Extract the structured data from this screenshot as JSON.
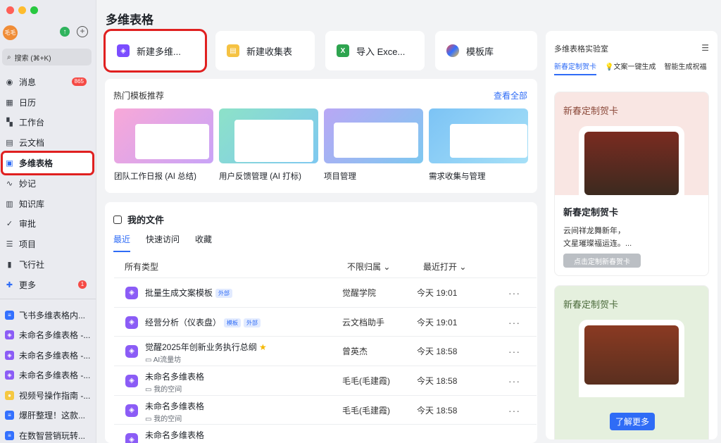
{
  "sidebar": {
    "avatar": "毛毛",
    "search": "搜索 (⌘+K)",
    "items": [
      {
        "label": "消息",
        "icon": "message-icon",
        "badge": "865"
      },
      {
        "label": "日历",
        "icon": "calendar-icon"
      },
      {
        "label": "工作台",
        "icon": "workbench-icon"
      },
      {
        "label": "云文档",
        "icon": "doc-icon"
      },
      {
        "label": "多维表格",
        "icon": "base-icon"
      },
      {
        "label": "妙记",
        "icon": "minutes-icon"
      },
      {
        "label": "知识库",
        "icon": "wiki-icon"
      },
      {
        "label": "审批",
        "icon": "approval-icon"
      },
      {
        "label": "项目",
        "icon": "project-icon"
      },
      {
        "label": "飞行社",
        "icon": "community-icon"
      },
      {
        "label": "更多",
        "icon": "more-apps-icon",
        "badge": "1"
      }
    ],
    "recent": [
      "飞书多维表格内...",
      "未命名多维表格 -...",
      "未命名多维表格 -...",
      "未命名多维表格 -...",
      "视频号操作指南 -...",
      "爆肝整理！这款...",
      "在数智营销玩转..."
    ]
  },
  "main": {
    "title": "多维表格",
    "quick": [
      "新建多维...",
      "新建收集表",
      "导入 Exce...",
      "模板库"
    ],
    "hot": {
      "title": "热门模板推荐",
      "view_all": "查看全部",
      "templates": [
        "团队工作日报 (AI 总结)",
        "用户反馈管理 (AI 打标)",
        "项目管理",
        "需求收集与管理"
      ]
    },
    "files": {
      "title": "我的文件",
      "tabs": [
        "最近",
        "快速访问",
        "收藏"
      ],
      "col_type": "所有类型",
      "col_owner": "不限归属",
      "col_time": "最近打开",
      "rows": [
        {
          "name": "批量生成文案模板",
          "tags": [
            "外部"
          ],
          "owner": "觉醒学院",
          "time": "今天 19:01"
        },
        {
          "name": "经营分析（仪表盘）",
          "tags": [
            "模板",
            "外部"
          ],
          "owner": "云文档助手",
          "time": "今天 19:01"
        },
        {
          "name": "觉醒2025年创新业务执行总纲",
          "sub": "AI流量坊",
          "owner": "曾英杰",
          "time": "今天 18:58"
        },
        {
          "name": "未命名多维表格",
          "sub": "我的空间",
          "owner": "毛毛(毛建霞)",
          "time": "今天 18:58"
        },
        {
          "name": "未命名多维表格",
          "sub": "我的空间",
          "owner": "毛毛(毛建霞)",
          "time": "今天 18:58"
        },
        {
          "name": "未命名多维表格",
          "owner": "",
          "time": ""
        }
      ]
    }
  },
  "right": {
    "title": "多维表格实验室",
    "tabs": [
      "新春定制贺卡",
      "文案一键生成",
      "智能生成祝福"
    ],
    "card1": {
      "title": "新春定制贺卡",
      "heading": "新春定制贺卡",
      "line1": "云间祥龙舞新年，",
      "line2": "文星璀璨福运连。...",
      "button": "点击定制新春贺卡"
    },
    "card2": {
      "title": "新春定制贺卡"
    },
    "learn_more": "了解更多"
  },
  "colors": {
    "accent": "#2f6cf6",
    "highlight": "#e02020",
    "base_icon": "#8b5cf6"
  }
}
